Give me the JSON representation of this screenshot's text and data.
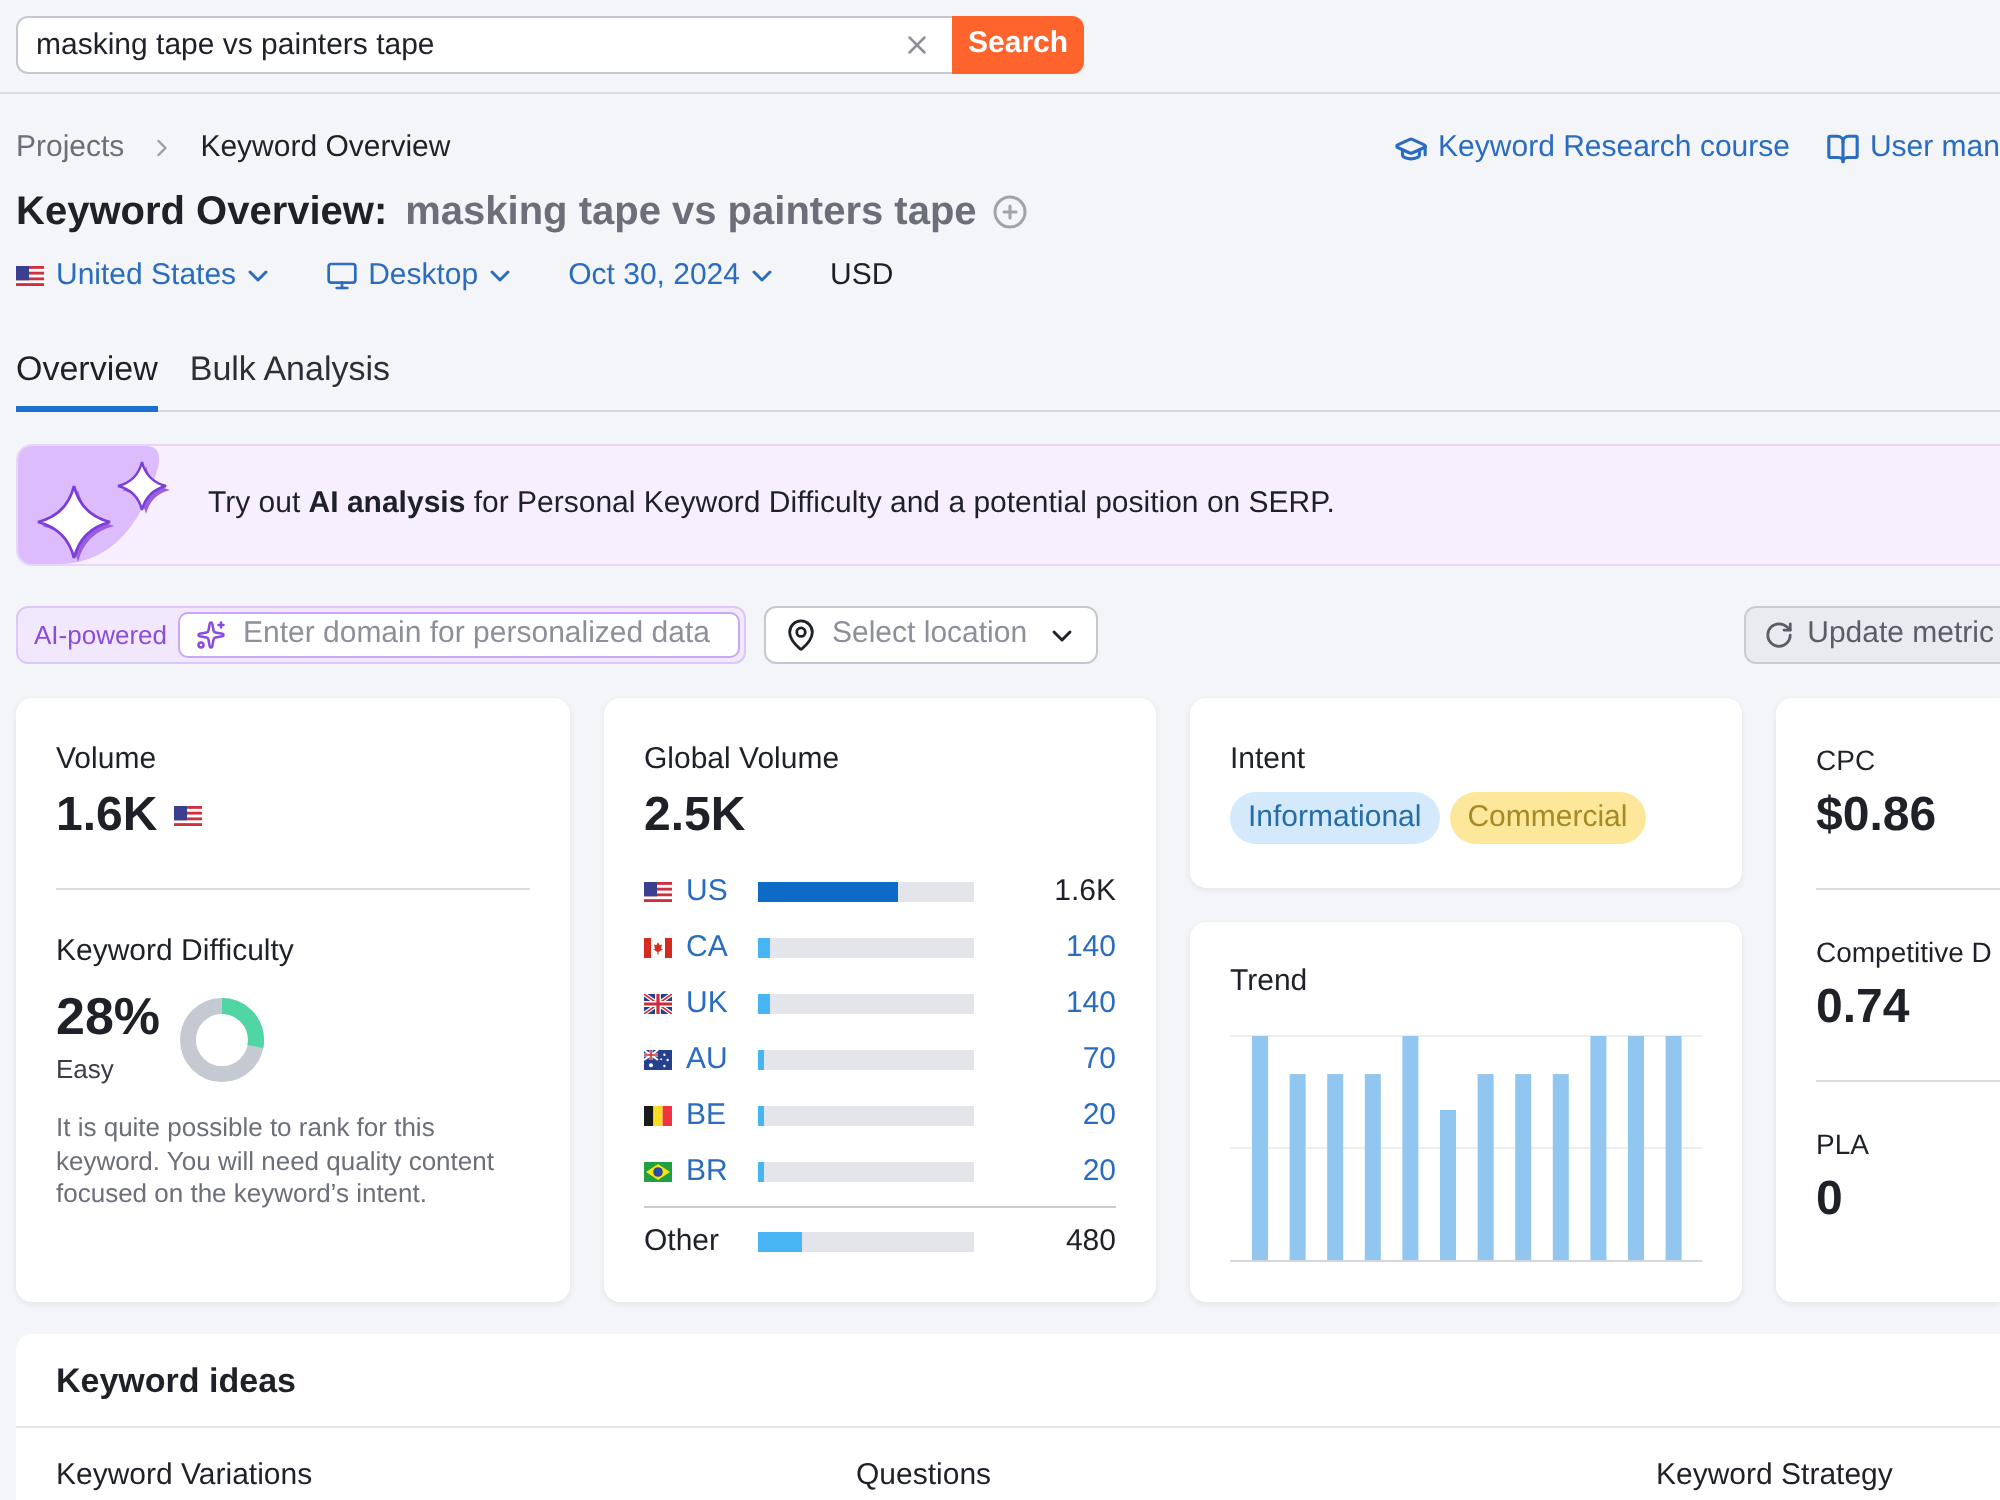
{
  "search": {
    "value": "masking tape vs painters tape",
    "button": "Search"
  },
  "breadcrumbs": [
    {
      "label": "Projects"
    },
    {
      "label": "Keyword Overview"
    }
  ],
  "help_links": [
    {
      "kind": "course",
      "label": "Keyword Research course"
    },
    {
      "kind": "manual",
      "label": "User man"
    }
  ],
  "title": {
    "label": "Keyword Overview:",
    "keyword": "masking tape vs painters tape"
  },
  "filters": [
    {
      "kind": "country",
      "flag": {
        "kind": "us"
      },
      "label": "United States"
    },
    {
      "kind": "device",
      "label": "Desktop"
    },
    {
      "kind": "date",
      "label": "Oct 30, 2024"
    },
    {
      "kind": "currency",
      "label": "USD"
    }
  ],
  "tabs": [
    {
      "label": "Overview",
      "selected": true
    },
    {
      "label": "Bulk Analysis",
      "selected": false
    }
  ],
  "banner": {
    "text": "Try out **AI analysis** for Personal Keyword Difficulty and a potential position on SERP."
  },
  "ai_bar": {
    "badge": "AI-powered",
    "domain_field": {
      "placeholder": "Enter domain for personalized data"
    },
    "location_select": {
      "placeholder": "Select location"
    },
    "update_button": "Update metric"
  },
  "volume": {
    "label": "Volume",
    "value": "1.6K",
    "flag": {
      "kind": "us"
    }
  },
  "keyword_difficulty": {
    "label": "Keyword Difficulty",
    "value": "28%",
    "rating": "Easy",
    "level": 0.28,
    "description": "It is quite possible to rank for this keyword. You will need quality content focused on the keyword’s intent."
  },
  "global_volume": {
    "label": "Global Volume",
    "value": "2.5K",
    "countries": [
      {
        "flag": {
          "kind": "us"
        },
        "code": "US",
        "level": 0.65,
        "value": "1.6K",
        "selected": true
      },
      {
        "flag": {
          "kind": "ca"
        },
        "code": "CA",
        "level": 0.06,
        "value": "140",
        "selected": false
      },
      {
        "flag": {
          "kind": "uk"
        },
        "code": "UK",
        "level": 0.06,
        "value": "140",
        "selected": false
      },
      {
        "flag": {
          "kind": "au"
        },
        "code": "AU",
        "level": 0.03,
        "value": "70",
        "selected": false
      },
      {
        "flag": {
          "kind": "be"
        },
        "code": "BE",
        "level": 0.03,
        "value": "20",
        "selected": false
      },
      {
        "flag": {
          "kind": "br"
        },
        "code": "BR",
        "level": 0.03,
        "value": "20",
        "selected": false
      }
    ],
    "other": {
      "label": "Other",
      "level": 0.2,
      "value": "480"
    }
  },
  "intent": {
    "label": "Intent",
    "tags": [
      {
        "label": "Informational",
        "color": "#d4eafc"
      },
      {
        "label": "Commercial",
        "color": "#fce79a"
      }
    ]
  },
  "trend": {
    "label": "Trend"
  },
  "metrics": [
    {
      "label": "CPC",
      "value": "$0.86"
    },
    {
      "label": "Competitive D",
      "value": "0.74"
    },
    {
      "label": "PLA",
      "value": "0"
    }
  ],
  "keyword_ideas": {
    "title": "Keyword ideas",
    "columns": [
      "Keyword Variations",
      "Questions",
      "Keyword Strategy"
    ]
  }
}
